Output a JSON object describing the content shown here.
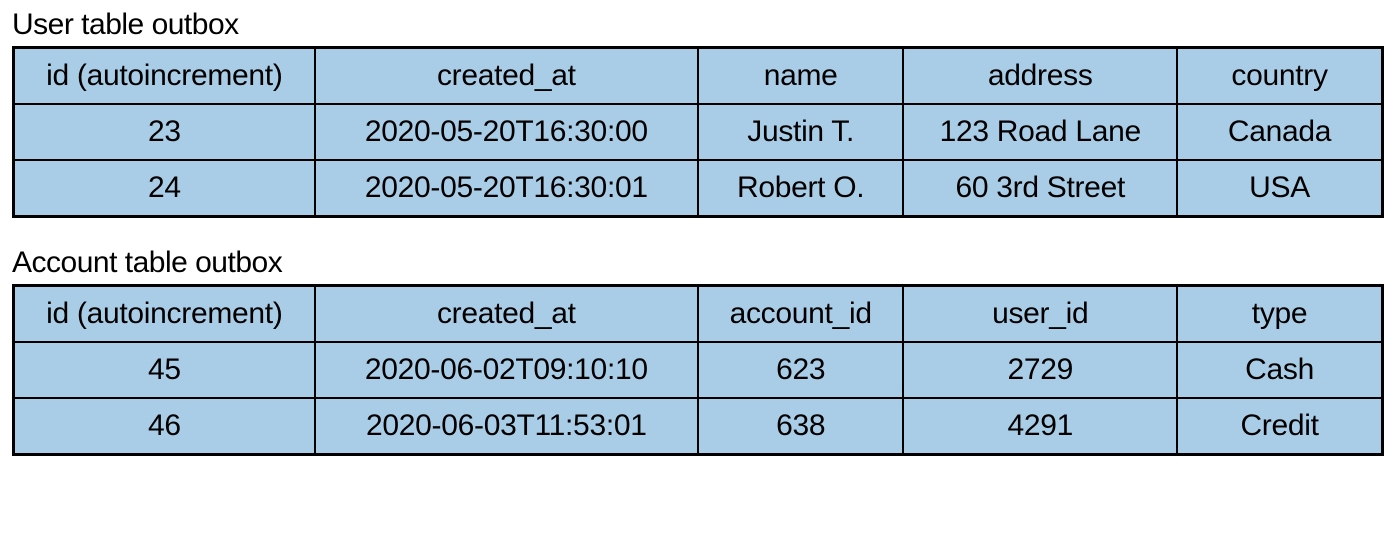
{
  "tables": [
    {
      "title": "User table outbox",
      "headers": [
        "id (autoincrement)",
        "created_at",
        "name",
        "address",
        "country"
      ],
      "rows": [
        [
          "23",
          "2020-05-20T16:30:00",
          "Justin T.",
          "123 Road Lane",
          "Canada"
        ],
        [
          "24",
          "2020-05-20T16:30:01",
          "Robert O.",
          "60 3rd Street",
          "USA"
        ]
      ]
    },
    {
      "title": "Account table outbox",
      "headers": [
        "id (autoincrement)",
        "created_at",
        "account_id",
        "user_id",
        "type"
      ],
      "rows": [
        [
          "45",
          "2020-06-02T09:10:10",
          "623",
          "2729",
          "Cash"
        ],
        [
          "46",
          "2020-06-03T11:53:01",
          "638",
          "4291",
          "Credit"
        ]
      ]
    }
  ]
}
